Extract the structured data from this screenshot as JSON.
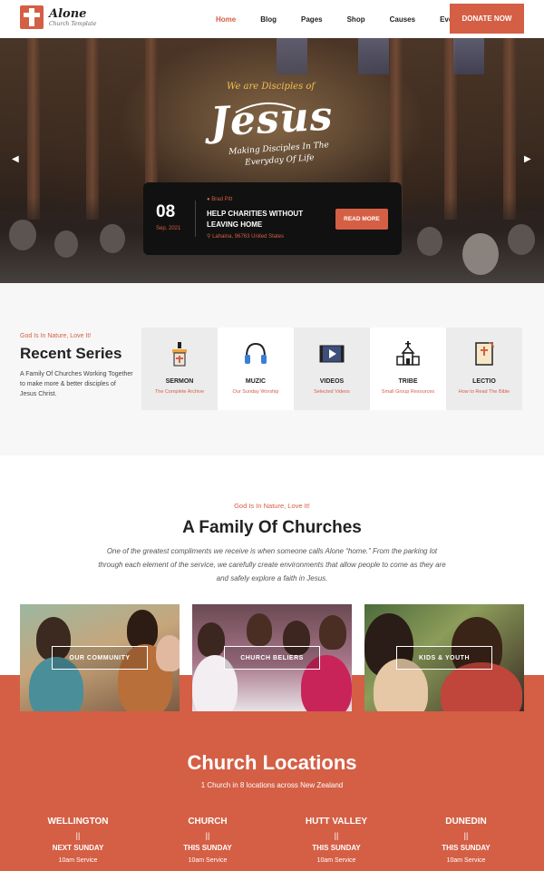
{
  "brand": {
    "name": "Alone",
    "tagline": "Church Template"
  },
  "nav": {
    "items": [
      {
        "label": "Home",
        "active": true
      },
      {
        "label": "Blog",
        "active": false
      },
      {
        "label": "Pages",
        "active": false
      },
      {
        "label": "Shop",
        "active": false
      },
      {
        "label": "Causes",
        "active": false
      },
      {
        "label": "Events",
        "active": false
      }
    ],
    "donate_label": "Donate Now"
  },
  "hero": {
    "script_top": "We are Disciples of",
    "script_main": "Jesus",
    "script_sub": "Making Disciples In The Everyday Of Life",
    "prev_icon": "chevron-left-icon",
    "next_icon": "chevron-right-icon",
    "event": {
      "day": "08",
      "month": "Sep, 2021",
      "author": "Brad Pitt",
      "title": "Help Charities Without Leaving Home",
      "location": "Lahaina, 96763 United States",
      "button": "Read More"
    }
  },
  "series": {
    "eyebrow": "God Is In Nature, Love It!",
    "title": "Recent Series",
    "description": "A Family Of Churches Working Together to make more & better disciples of Jesus Christ.",
    "items": [
      {
        "name": "Sermon",
        "sub": "The Complete Archive",
        "icon": "pulpit-icon"
      },
      {
        "name": "Muzic",
        "sub": "Our Sunday Worship",
        "icon": "headphones-icon"
      },
      {
        "name": "Videos",
        "sub": "Selected Videos",
        "icon": "video-icon"
      },
      {
        "name": "Tribe",
        "sub": "Small Group Resources",
        "icon": "church-icon"
      },
      {
        "name": "Lectio",
        "sub": "How to Read The Bible",
        "icon": "bible-icon"
      }
    ]
  },
  "family": {
    "eyebrow": "God Is In Nature, Love It!",
    "title": "A Family Of Churches",
    "description": "One of the greatest compliments we receive is when someone calls Alone “home.” From the parking lot through each element of the service, we carefully create environments that allow people to come as they are and safely explore a faith in Jesus.",
    "cards": [
      {
        "label": "Our Community"
      },
      {
        "label": "Church Beliers"
      },
      {
        "label": "Kids & Youth"
      }
    ]
  },
  "locations": {
    "title": "Church Locations",
    "subtitle": "1 Church in 8 locations across New Zealand",
    "items": [
      {
        "city": "Wellington",
        "separator": "||",
        "day": "Next Sunday",
        "time": "10am Service"
      },
      {
        "city": "Church",
        "separator": "||",
        "day": "This Sunday",
        "time": "10am Service"
      },
      {
        "city": "Hutt Valley",
        "separator": "||",
        "day": "This Sunday",
        "time": "10am Service"
      },
      {
        "city": "Dunedin",
        "separator": "||",
        "day": "This Sunday",
        "time": "10am Service"
      }
    ]
  },
  "colors": {
    "accent": "#d45f45",
    "dark": "#111111",
    "light_bg": "#f8f7f7"
  }
}
